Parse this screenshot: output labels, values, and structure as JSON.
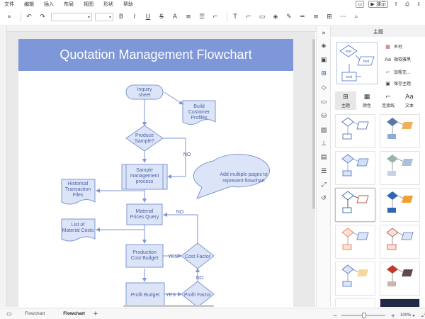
{
  "menubar": {
    "items": [
      "文件",
      "编辑",
      "插入",
      "布局",
      "视图",
      "形状",
      "帮助"
    ],
    "present_label": "演示"
  },
  "canvas": {
    "title": "Quotation Management Flowchart",
    "title_band_color": "#7e97d8",
    "shape_stroke": "#7f96d0",
    "shape_fill": "#dce5f7",
    "nodes": {
      "inquiry": "Inquiry\nsheet",
      "build_profiles": "Build\nCustomer\nProfiles",
      "produce_sample": "Produce\nSample?",
      "sample_mgmt": "Sample\nmanagement\nprocess",
      "historical": "Historical\nTransaction\nFiles",
      "material_query": "Material\nPrices Query",
      "list_costs": "List of\nMaterial Costs",
      "production_budget": "Production\nCost Budget",
      "cost_factor": "Cost Factor",
      "profit_budget": "Profit Budget",
      "profit_factor": "Profit Factor",
      "callout": "Add multiple pages to\nrepresent flowchart"
    },
    "labels": {
      "no1": "NO",
      "no2": "NO",
      "no3": "NO",
      "yes1": "YES",
      "yes2": "YES"
    }
  },
  "panel": {
    "title": "主题",
    "options": [
      "乡村",
      "微软雅黑",
      "加粗无...",
      "保存主题"
    ],
    "tabs": [
      "主题",
      "颜色",
      "连接线",
      "文本"
    ],
    "preview_labels": [
      "text",
      "text",
      "text"
    ]
  },
  "bottombar": {
    "tabs": [
      "Flowchart",
      "Flowchart"
    ],
    "zoom": "100%"
  },
  "colors": {
    "accent_blue": "#4a72c8",
    "orange": "#f0b05a",
    "red": "#c0504d",
    "dark_blue": "#2e67b1"
  }
}
